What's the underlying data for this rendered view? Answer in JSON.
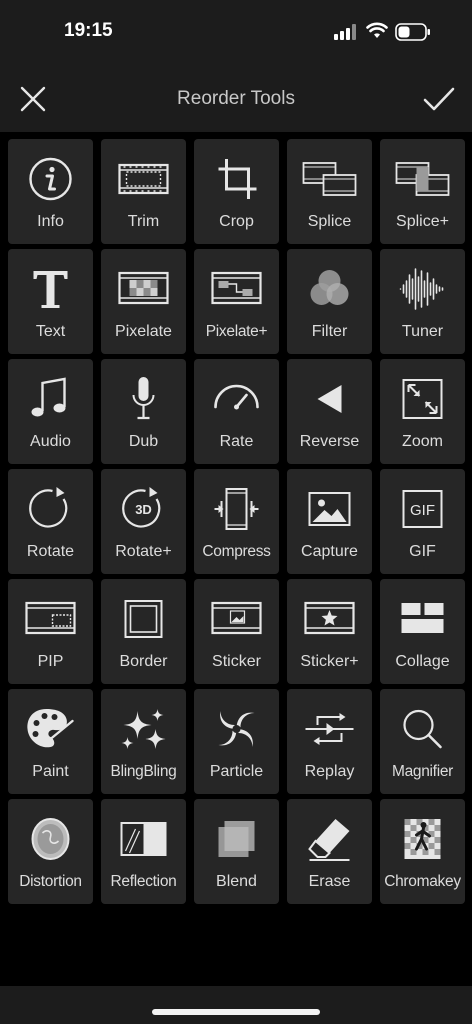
{
  "status": {
    "time": "19:15"
  },
  "header": {
    "title": "Reorder Tools"
  },
  "tools": [
    {
      "label": "Info",
      "icon": "info-icon"
    },
    {
      "label": "Trim",
      "icon": "trim-icon"
    },
    {
      "label": "Crop",
      "icon": "crop-icon"
    },
    {
      "label": "Splice",
      "icon": "splice-icon"
    },
    {
      "label": "Splice+",
      "icon": "splice-plus-icon"
    },
    {
      "label": "Text",
      "icon": "text-icon"
    },
    {
      "label": "Pixelate",
      "icon": "pixelate-icon"
    },
    {
      "label": "Pixelate+",
      "icon": "pixelate-plus-icon"
    },
    {
      "label": "Filter",
      "icon": "filter-icon"
    },
    {
      "label": "Tuner",
      "icon": "tuner-icon"
    },
    {
      "label": "Audio",
      "icon": "music-note-icon"
    },
    {
      "label": "Dub",
      "icon": "microphone-icon"
    },
    {
      "label": "Rate",
      "icon": "speedometer-icon"
    },
    {
      "label": "Reverse",
      "icon": "reverse-icon"
    },
    {
      "label": "Zoom",
      "icon": "zoom-arrows-icon"
    },
    {
      "label": "Rotate",
      "icon": "rotate-icon"
    },
    {
      "label": "Rotate+",
      "icon": "rotate-3d-icon"
    },
    {
      "label": "Compress",
      "icon": "compress-icon"
    },
    {
      "label": "Capture",
      "icon": "image-icon"
    },
    {
      "label": "GIF",
      "icon": "gif-icon"
    },
    {
      "label": "PIP",
      "icon": "pip-icon"
    },
    {
      "label": "Border",
      "icon": "border-icon"
    },
    {
      "label": "Sticker",
      "icon": "sticker-icon"
    },
    {
      "label": "Sticker+",
      "icon": "sticker-plus-icon"
    },
    {
      "label": "Collage",
      "icon": "collage-icon"
    },
    {
      "label": "Paint",
      "icon": "palette-icon"
    },
    {
      "label": "BlingBling",
      "icon": "sparkles-icon"
    },
    {
      "label": "Particle",
      "icon": "swirl-icon"
    },
    {
      "label": "Replay",
      "icon": "replay-icon"
    },
    {
      "label": "Magnifier",
      "icon": "magnifier-icon"
    },
    {
      "label": "Distortion",
      "icon": "distortion-icon"
    },
    {
      "label": "Reflection",
      "icon": "reflection-icon"
    },
    {
      "label": "Blend",
      "icon": "blend-icon"
    },
    {
      "label": "Erase",
      "icon": "eraser-icon"
    },
    {
      "label": "Chromakey",
      "icon": "chromakey-icon"
    }
  ],
  "colors": {
    "background": "#000000",
    "bar": "#1c1c1c",
    "tile": "#262626",
    "icon": "#e6e6e6"
  }
}
